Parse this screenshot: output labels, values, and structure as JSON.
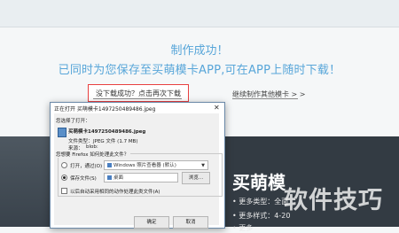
{
  "page": {
    "success_title": "制作成功！",
    "subtitle": "已同时为您保存至买萌模卡APP,可在APP上随时下载！",
    "retry_link": "没下载成功？点击再次下载",
    "continue_link": "继续制作其他模卡 > >",
    "promo_title": "买萌模",
    "promo_lines": [
      "• 更多类型：全面",
      "• 更多样式：4-20",
      "• 更多"
    ],
    "watermark": "软件技巧"
  },
  "dialog": {
    "title": "正在打开 买萌模卡1497250489486.jpeg",
    "choose_open": "您选择了打开：",
    "filename": "买萌模卡1497250489486.jpeg",
    "file_type_label": "文件类型：",
    "file_type_value": "JPEG 文件 (1.7 MB)",
    "source_label": "来源：",
    "source_value": "blob:",
    "question": "您想要 Firefox 如何处理此文件？",
    "open_with_label": "打开，通过(O)",
    "open_with_value": "Windows 照片查看器 (默认)",
    "save_label": "保存文件(S)",
    "save_path": "桌面",
    "browse_button": "浏览...",
    "remember_label": "以后自动采用相同的动作处理此类文件(A)",
    "ok_button": "确定",
    "cancel_button": "取消"
  }
}
